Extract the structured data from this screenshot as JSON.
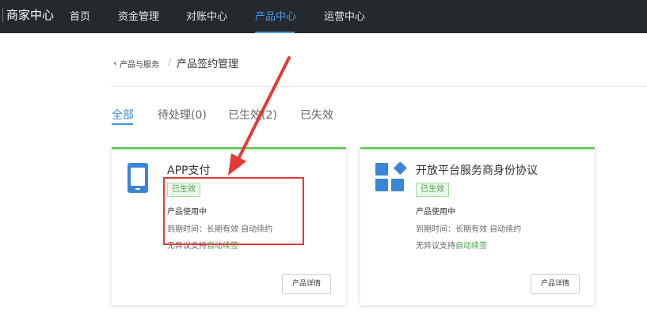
{
  "header": {
    "brand": "商家中心",
    "nav": [
      {
        "label": "首页",
        "active": false
      },
      {
        "label": "资金管理",
        "active": false
      },
      {
        "label": "对账中心",
        "active": false
      },
      {
        "label": "产品中心",
        "active": true
      },
      {
        "label": "运营中心",
        "active": false
      }
    ]
  },
  "breadcrumb": {
    "back_icon": "‹",
    "parent": "产品与服务",
    "separator": "/",
    "current": "产品签约管理"
  },
  "tabs": [
    {
      "label": "全部",
      "active": true
    },
    {
      "label": "待处理(0)",
      "active": false
    },
    {
      "label": "已生效(2)",
      "active": false
    },
    {
      "label": "已失效",
      "active": false
    }
  ],
  "cards": [
    {
      "icon": "mobile-phone-icon",
      "title": "APP支付",
      "badge": "已生效",
      "status": "产品使用中",
      "expire_label": "到期时间：",
      "expire_value": "长期有效 自动续约",
      "renew_label": "无异议支持",
      "renew_link": "自动续签",
      "detail_button": "产品详情"
    },
    {
      "icon": "app-grid-icon",
      "title": "开放平台服务商身份协议",
      "badge": "已生效",
      "status": "产品使用中",
      "expire_label": "到期时间：",
      "expire_value": "长期有效 自动续约",
      "renew_label": "无异议支持",
      "renew_link": "自动续签",
      "detail_button": "产品详情"
    }
  ],
  "colors": {
    "topbar": "#25292e",
    "accent_blue": "#4a9ce6",
    "card_top_border": "#6ccb5f",
    "badge_green": "#43a047",
    "annotation_red": "#e53935",
    "icon_blue": "#3a86d6"
  },
  "annotation": {
    "type": "red-arrow-and-box"
  }
}
